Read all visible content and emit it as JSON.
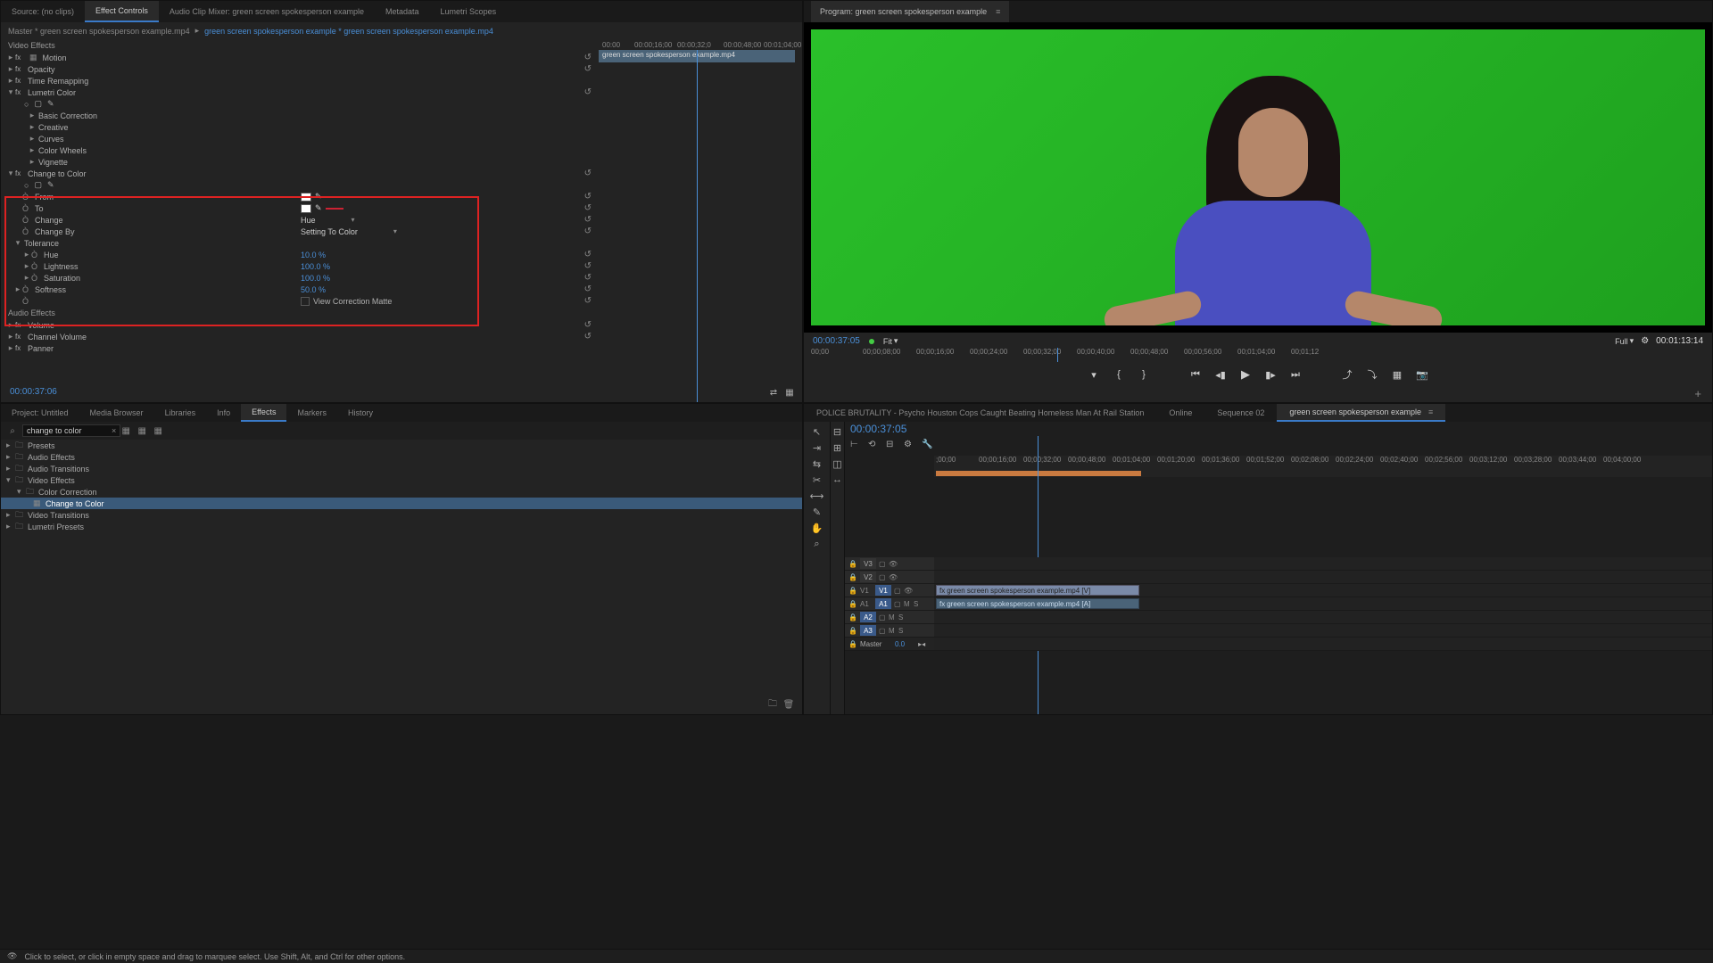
{
  "effectControls": {
    "tabs": [
      "Source: (no clips)",
      "Effect Controls",
      "Audio Clip Mixer: green screen spokesperson example",
      "Metadata",
      "Lumetri Scopes"
    ],
    "activeTab": 1,
    "breadcrumb": {
      "master": "Master * green screen spokesperson example.mp4",
      "arrow": "▸",
      "seq": "green screen spokesperson example * green screen spokesperson example.mp4"
    },
    "miniTimes": [
      "00:00",
      "00:00;16;00",
      "00:00;32;0",
      "00:00;48;00",
      "00:01;04;00"
    ],
    "clipLabel": "green screen spokesperson example.mp4",
    "sectionVideo": "Video Effects",
    "sectionAudio": "Audio Effects",
    "fx": {
      "motion": "Motion",
      "opacity": "Opacity",
      "timeRemap": "Time Remapping",
      "lumetri": "Lumetri Color",
      "lum_basic": "Basic Correction",
      "lum_creative": "Creative",
      "lum_curves": "Curves",
      "lum_wheels": "Color Wheels",
      "lum_vignette": "Vignette",
      "change": "Change to Color",
      "volume": "Volume",
      "chanVol": "Channel Volume",
      "panner": "Panner"
    },
    "ctc": {
      "from": "From",
      "to": "To",
      "change": "Change",
      "changeVal": "Hue",
      "changeBy": "Change By",
      "changeByVal": "Setting To Color",
      "tolerance": "Tolerance",
      "hue": "Hue",
      "hueVal": "10.0 %",
      "lightness": "Lightness",
      "lightVal": "100.0 %",
      "saturation": "Saturation",
      "satVal": "100.0 %",
      "softness": "Softness",
      "softVal": "50.0 %",
      "viewMatte": "View Correction Matte"
    },
    "timecode": "00:00:37:06"
  },
  "program": {
    "tabTitle": "Program: green screen spokesperson example",
    "tcLeft": "00:00:37:05",
    "fit": "Fit",
    "full": "Full",
    "tcRight": "00:01:13:14",
    "miniTimes": [
      "00;00",
      "00;00;08;00",
      "00;00;16;00",
      "00;00;24;00",
      "00;00;32;00",
      "00;00;40;00",
      "00;00;48;00",
      "00;00;56;00",
      "00;01;04;00",
      "00;01;12"
    ]
  },
  "project": {
    "tabs": [
      "Project: Untitled",
      "Media Browser",
      "Libraries",
      "Info",
      "Effects",
      "Markers",
      "History"
    ],
    "activeTab": 4,
    "search": "change to color",
    "tree": {
      "presets": "Presets",
      "audioFx": "Audio Effects",
      "audioTr": "Audio Transitions",
      "videoFx": "Video Effects",
      "colorCorr": "Color Correction",
      "changeToColor": "Change to Color",
      "videoTr": "Video Transitions",
      "lumetriPr": "Lumetri Presets"
    }
  },
  "timeline": {
    "tabs": [
      "POLICE BRUTALITY - Psycho Houston Cops Caught Beating Homeless Man At Rail Station",
      "Online",
      "Sequence 02",
      "green screen spokesperson example"
    ],
    "activeTab": 3,
    "tc": "00:00:37:05",
    "ruler": [
      ";00;00",
      "00;00;16;00",
      "00;00;32;00",
      "00;00;48;00",
      "00;01;04;00",
      "00;01;20;00",
      "00;01;36;00",
      "00;01;52;00",
      "00;02;08;00",
      "00;02;24;00",
      "00;02;40;00",
      "00;02;56;00",
      "00;03;12;00",
      "00;03;28;00",
      "00;03;44;00",
      "00;04;00;00"
    ],
    "tracks": {
      "v3": "V3",
      "v2": "V2",
      "v1": "V1",
      "a1": "A1",
      "a2": "A2",
      "a3": "A3",
      "master": "Master",
      "masterVol": "0.0"
    },
    "clipV": "green screen spokesperson example.mp4 [V]",
    "clipA": "green screen spokesperson example.mp4 [A]"
  },
  "statusbar": "Click to select, or click in empty space and drag to marquee select. Use Shift, Alt, and Ctrl for other options."
}
